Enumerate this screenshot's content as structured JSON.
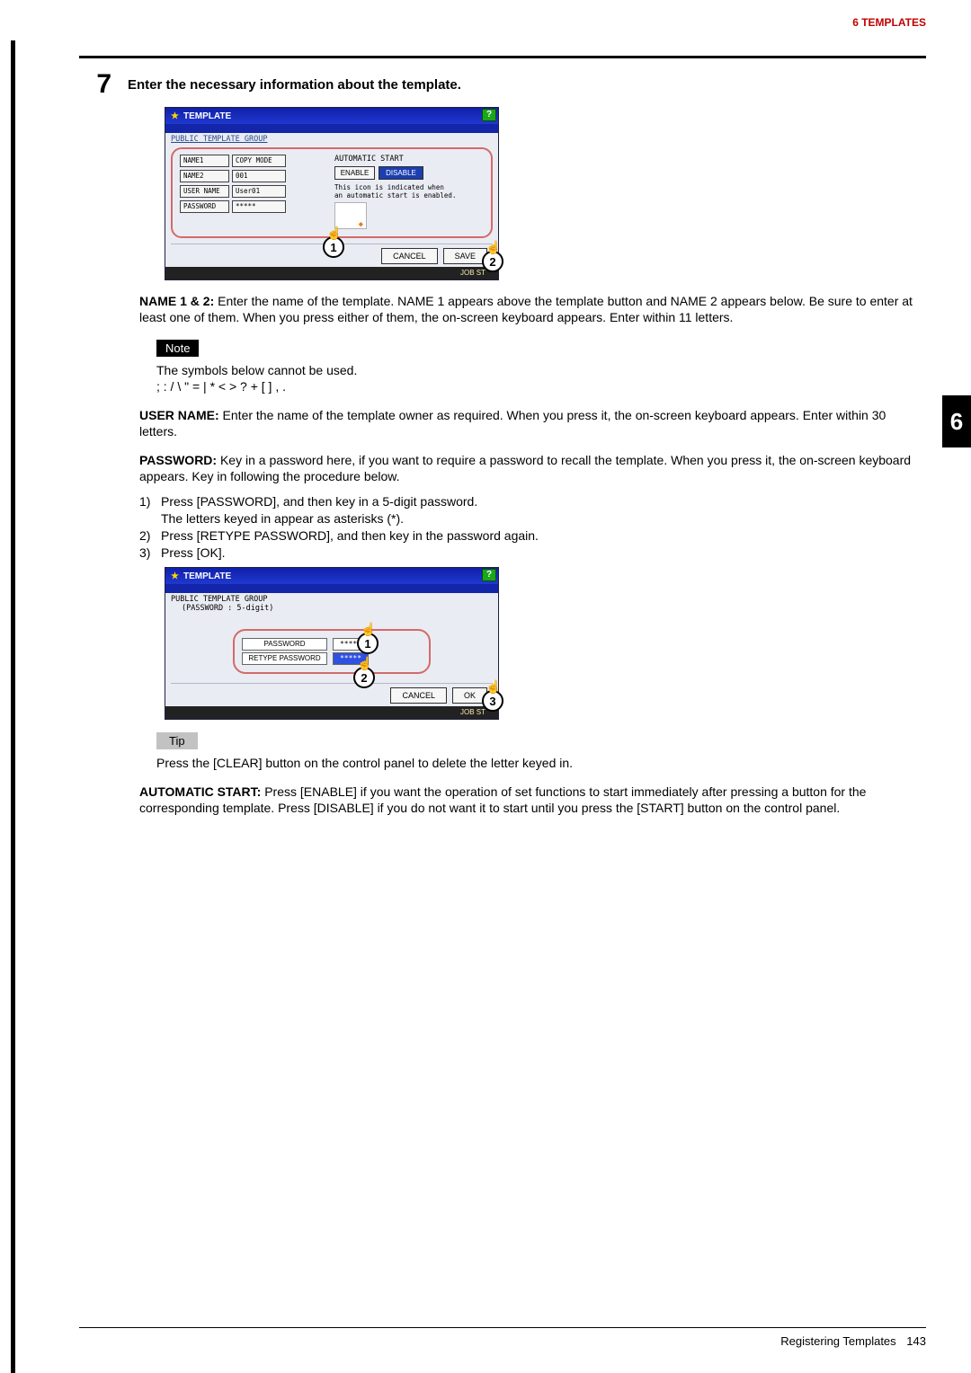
{
  "header": {
    "breadcrumb": "6 TEMPLATES"
  },
  "tab_number": "6",
  "step": {
    "number": "7",
    "title": "Enter the necessary information about the template."
  },
  "tpl1": {
    "title": "TEMPLATE",
    "help": "?",
    "group": "PUBLIC TEMPLATE GROUP",
    "name1_label": "NAME1",
    "name1_value": "COPY MODE",
    "name2_label": "NAME2",
    "name2_value": "001",
    "user_label": "USER NAME",
    "user_value": "User01",
    "pass_label": "PASSWORD",
    "pass_value": "*****",
    "auto_title": "AUTOMATIC START",
    "enable": "ENABLE",
    "disable": "DISABLE",
    "auto_note": "This icon is indicated when\nan automatic start is enabled.",
    "cancel": "CANCEL",
    "save": "SAVE",
    "status": "JOB ST",
    "callout1": "1",
    "callout2": "2"
  },
  "desc_name": {
    "label": "NAME 1 & 2:",
    "body": " Enter the name of the template. NAME 1 appears above the template button and NAME 2 appears below. Be sure to enter at least one of them. When you press either of them, the on-screen keyboard appears. Enter within 11 letters."
  },
  "note": {
    "label": "Note",
    "line1": "The symbols below cannot be used.",
    "line2": "; : / \\ \" = | * < > ? + [ ] , ."
  },
  "desc_user": {
    "label": "USER NAME:",
    "body": " Enter the name of the template owner as required. When you press it, the on-screen keyboard appears. Enter within 30 letters."
  },
  "desc_pass": {
    "label": "PASSWORD:",
    "body": " Key in a password here, if you want to require a password to recall the template. When you press it, the on-screen keyboard appears. Key in following the procedure below."
  },
  "steps": {
    "s1a": "Press [PASSWORD], and then key in a 5-digit password.",
    "s1b": "The letters keyed in appear as asterisks (*).",
    "s2": "Press [RETYPE PASSWORD], and then key in the password again.",
    "s3": "Press [OK]."
  },
  "tpl2": {
    "title": "TEMPLATE",
    "help": "?",
    "group": "PUBLIC TEMPLATE GROUP",
    "subgroup": "(PASSWORD : 5-digit)",
    "pw_label": "PASSWORD",
    "pw_val": "*****",
    "rpw_label": "RETYPE PASSWORD",
    "rpw_val": "*****",
    "cancel": "CANCEL",
    "ok": "OK",
    "status": "JOB ST",
    "callout1": "1",
    "callout2": "2",
    "callout3": "3"
  },
  "tip": {
    "label": "Tip",
    "body": "Press the [CLEAR] button on the control panel to delete the letter keyed in."
  },
  "desc_auto": {
    "label": "AUTOMATIC START:",
    "body": " Press [ENABLE] if you want the operation of set functions to start immediately after pressing a button for the corresponding template. Press [DISABLE] if you do not want it to start until you press the [START] button on the control panel."
  },
  "footer": {
    "section": "Registering Templates",
    "page": "143"
  }
}
